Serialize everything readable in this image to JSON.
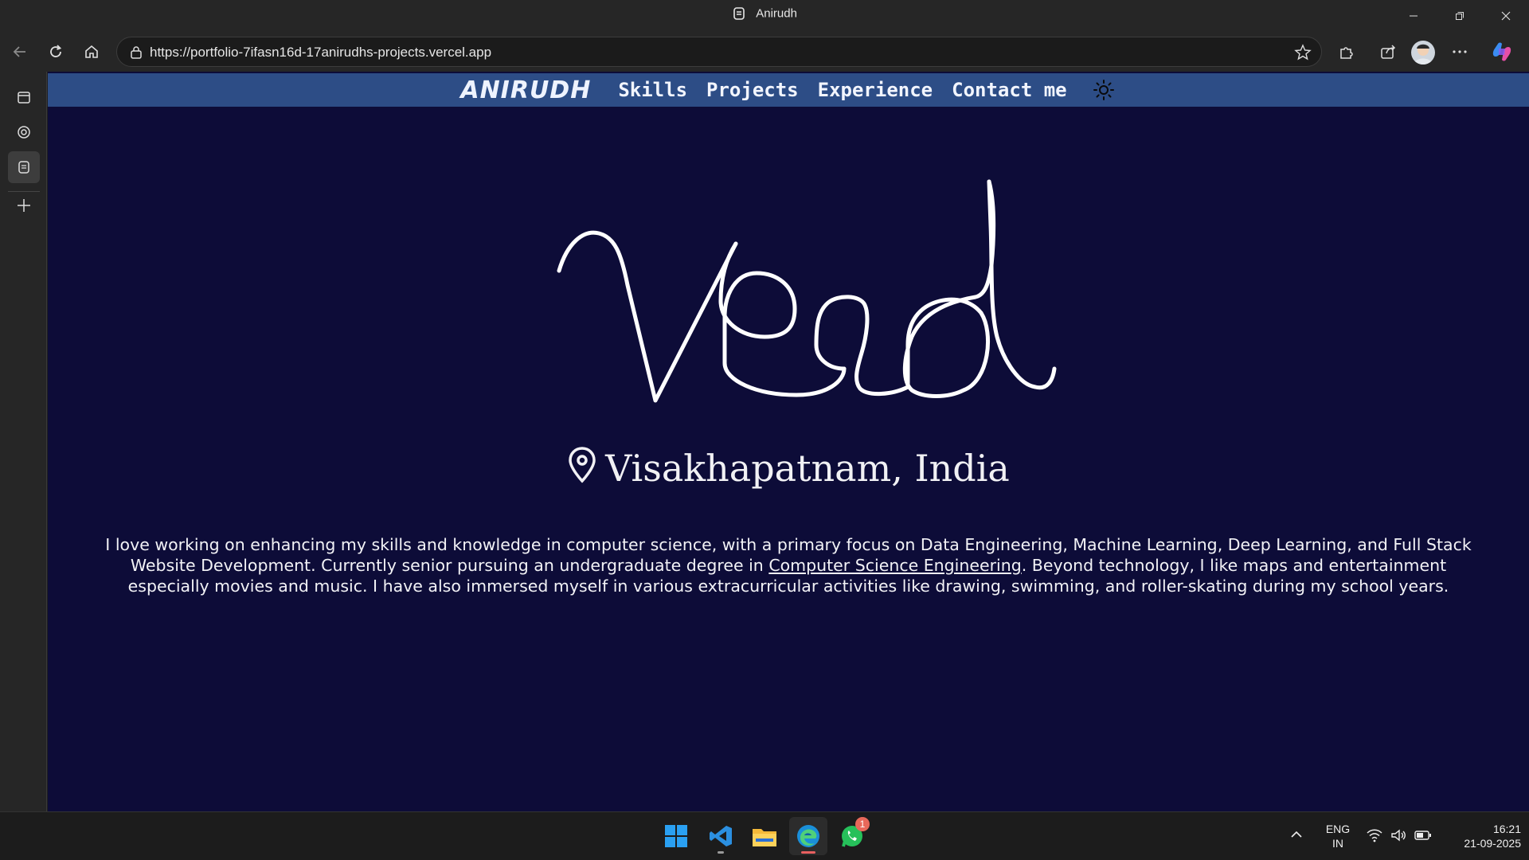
{
  "window": {
    "title": "Anirudh"
  },
  "browser": {
    "url": "https://portfolio-7ifasn16d-17anirudhs-projects.vercel.app"
  },
  "site": {
    "brand": "ANIRUDH",
    "nav": [
      "Skills",
      "Projects",
      "Experience",
      "Contact me"
    ],
    "location": "Visakhapatnam, India",
    "bio": {
      "part1": "I love working on enhancing my skills and knowledge in computer science, with a primary focus on Data Engineering, Machine Learning, Deep Learning, and Full Stack Website Development. Currently senior pursuing an undergraduate degree in ",
      "link": "Computer Science Engineering",
      "part2": ". Beyond technology, I like maps and entertainment especially movies and music. I have also immersed myself in various extracurricular activities like drawing, swimming, and roller-skating during my school years."
    },
    "colors": {
      "background": "#0d0c38",
      "nav": "#2d4d86",
      "text": "#f2f2f6"
    }
  },
  "taskbar": {
    "whatsapp_badge": "1",
    "language": {
      "line1": "ENG",
      "line2": "IN"
    },
    "time": "16:21",
    "date": "21-09-2025"
  }
}
